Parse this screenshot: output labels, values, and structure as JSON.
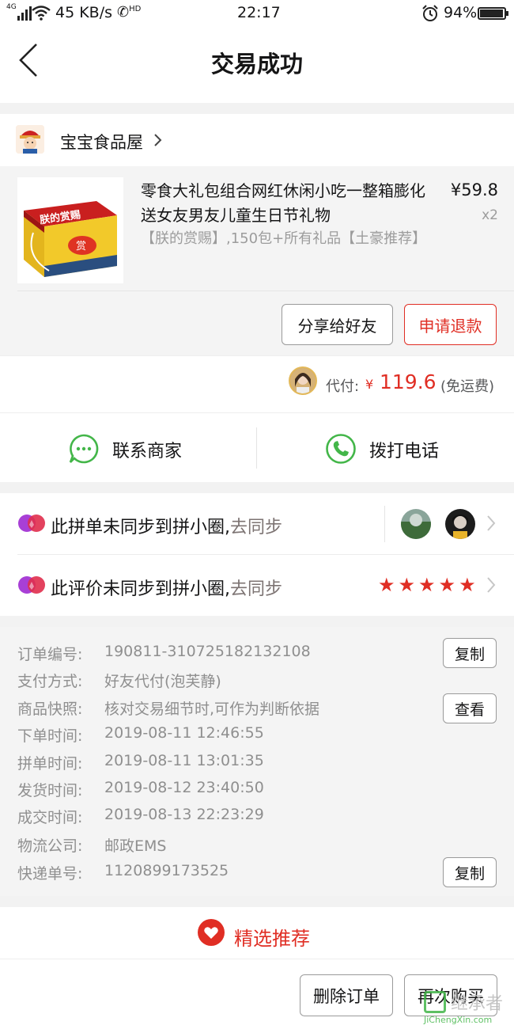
{
  "status_bar": {
    "network": "4G",
    "speed": "45 KB/s",
    "call_badge": "HD",
    "time": "22:17",
    "battery": "94%"
  },
  "header": {
    "title": "交易成功"
  },
  "shop": {
    "name": "宝宝食品屋",
    "product": {
      "title": "零食大礼包组合网红休闲小吃一整箱膨化送女友男友儿童生日节礼物",
      "subtitle": "【朕的赏赐】,150包+所有礼品【土豪推荐】",
      "image_text": "朕的赏赐",
      "image_seal": "赏",
      "price": "¥59.8",
      "quantity": "x2"
    },
    "buttons": {
      "share": "分享给好友",
      "refund": "申请退款"
    }
  },
  "payment": {
    "label": "代付:",
    "currency": "¥",
    "amount": "119.6",
    "note": "(免运费)"
  },
  "contact": {
    "merchant": "联系商家",
    "phone": "拨打电话"
  },
  "sync": {
    "group_text": "此拼单未同步到拼小圈,",
    "group_action": "去同步",
    "review_text": "此评价未同步到拼小圈,",
    "review_action": "去同步",
    "rating_stars": 5
  },
  "order_info": {
    "rows": [
      {
        "key": "订单编号:",
        "value": "190811-310725182132108"
      },
      {
        "key": "支付方式:",
        "value": "好友代付(泡芙静)"
      },
      {
        "key": "商品快照:",
        "value": "核对交易细节时,可作为判断依据"
      },
      {
        "key": "下单时间:",
        "value": "2019-08-11 12:46:55"
      },
      {
        "key": "拼单时间:",
        "value": "2019-08-11 13:01:35"
      },
      {
        "key": "发货时间:",
        "value": "2019-08-12 23:40:50"
      },
      {
        "key": "成交时间:",
        "value": "2019-08-13 22:23:29"
      },
      {
        "key": "物流公司:",
        "value": "邮政EMS"
      },
      {
        "key": "快递单号:",
        "value": "1120899173525"
      }
    ],
    "copy_label": "复制",
    "view_label": "查看"
  },
  "recommend": {
    "label": "精选推荐"
  },
  "bottom_bar": {
    "delete": "删除订单",
    "rebuy": "再次购买"
  },
  "watermark": {
    "text": "继承者",
    "url_text": "JiChengXin.com"
  },
  "colors": {
    "brand_red": "#e02e24",
    "wechat_green": "#43b649",
    "text_grey": "#8f8f8f"
  }
}
